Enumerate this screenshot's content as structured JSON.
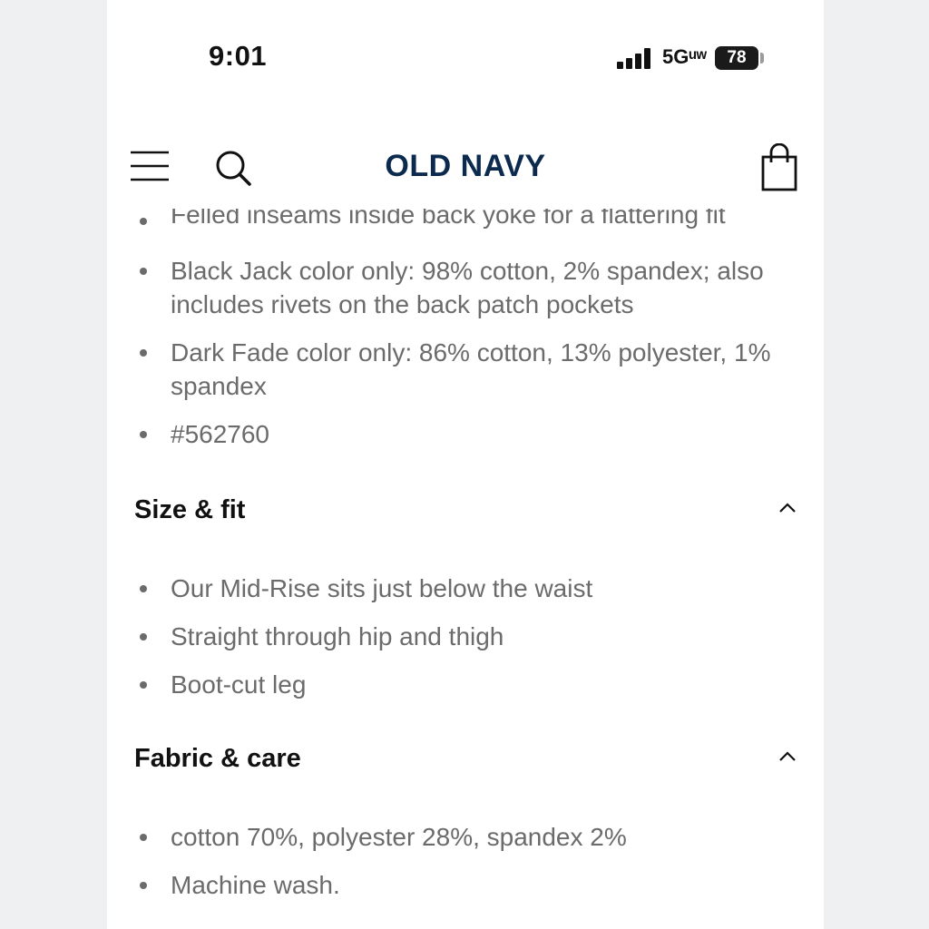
{
  "status_bar": {
    "time": "9:01",
    "network": "5Gᵘʷ",
    "battery": "78"
  },
  "header": {
    "brand": "OLD NAVY"
  },
  "details": {
    "clipped_item": "Felled inseams inside back yoke for a flattering fit",
    "items": [
      {
        "text": "Black Jack color only: 98% cotton, 2% spandex; also includes rivets on the back patch pockets"
      },
      {
        "text": "Dark Fade color only: 86% cotton, 13% polyester, 1% spandex"
      },
      {
        "text": "#562760"
      }
    ]
  },
  "size_fit": {
    "title": "Size & fit",
    "items": [
      {
        "text": "Our Mid-Rise sits just below the waist"
      },
      {
        "text": "Straight through hip and thigh"
      },
      {
        "text": "Boot-cut leg"
      }
    ]
  },
  "fabric_care": {
    "title": "Fabric & care",
    "items": [
      {
        "text": "cotton 70%, polyester 28%, spandex 2%"
      },
      {
        "text": "Machine wash."
      }
    ]
  },
  "colors": {
    "brand": "#0b2a4e",
    "body_text": "#6b6b6b",
    "heading": "#111111"
  },
  "icons": [
    "menu-icon",
    "search-icon",
    "shopping-bag-icon",
    "chevron-up-icon",
    "signal-icon",
    "battery-icon"
  ]
}
